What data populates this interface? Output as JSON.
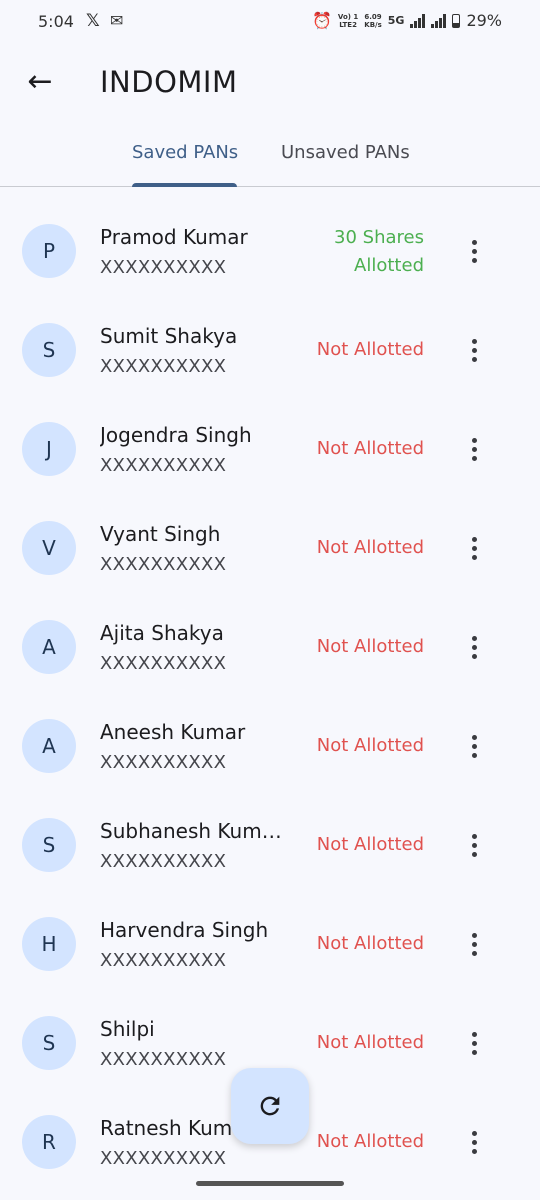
{
  "status_bar": {
    "time": "5:04",
    "volte": "Vo) 1\nLTE2",
    "speed": "6.09\nKB/s",
    "network": "5G",
    "battery": "29%"
  },
  "app_bar": {
    "title": "INDOMIM",
    "back_icon": "arrow-back-icon"
  },
  "tabs": [
    {
      "label": "Saved PANs",
      "selected": true
    },
    {
      "label": "Unsaved PANs",
      "selected": false
    }
  ],
  "colors": {
    "primary": "#3f5f88",
    "allotted": "#4caf50",
    "not_allotted": "#e0524f",
    "avatar_bg": "#d3e4ff",
    "background": "#f7f8fd"
  },
  "entries": [
    {
      "initial": "P",
      "name": "Pramod Kumar",
      "pan": "XXXXXXXXXX",
      "status": "30 Shares\nAllotted",
      "allotted": true
    },
    {
      "initial": "S",
      "name": "Sumit Shakya",
      "pan": "XXXXXXXXXX",
      "status": "Not Allotted",
      "allotted": false
    },
    {
      "initial": "J",
      "name": "Jogendra Singh",
      "pan": "XXXXXXXXXX",
      "status": "Not Allotted",
      "allotted": false
    },
    {
      "initial": "V",
      "name": "Vyant Singh",
      "pan": "XXXXXXXXXX",
      "status": "Not Allotted",
      "allotted": false
    },
    {
      "initial": "A",
      "name": "Ajita Shakya",
      "pan": "XXXXXXXXXX",
      "status": "Not Allotted",
      "allotted": false
    },
    {
      "initial": "A",
      "name": "Aneesh Kumar",
      "pan": "XXXXXXXXXX",
      "status": "Not Allotted",
      "allotted": false
    },
    {
      "initial": "S",
      "name": "Subhanesh Kum…",
      "pan": "XXXXXXXXXX",
      "status": "Not Allotted",
      "allotted": false
    },
    {
      "initial": "H",
      "name": "Harvendra Singh",
      "pan": "XXXXXXXXXX",
      "status": "Not Allotted",
      "allotted": false
    },
    {
      "initial": "S",
      "name": "Shilpi",
      "pan": "XXXXXXXXXX",
      "status": "Not Allotted",
      "allotted": false
    },
    {
      "initial": "R",
      "name": "Ratnesh Kum",
      "pan": "XXXXXXXXXX",
      "status": "Not Allotted",
      "allotted": false
    }
  ],
  "fab": {
    "icon": "refresh-icon"
  }
}
